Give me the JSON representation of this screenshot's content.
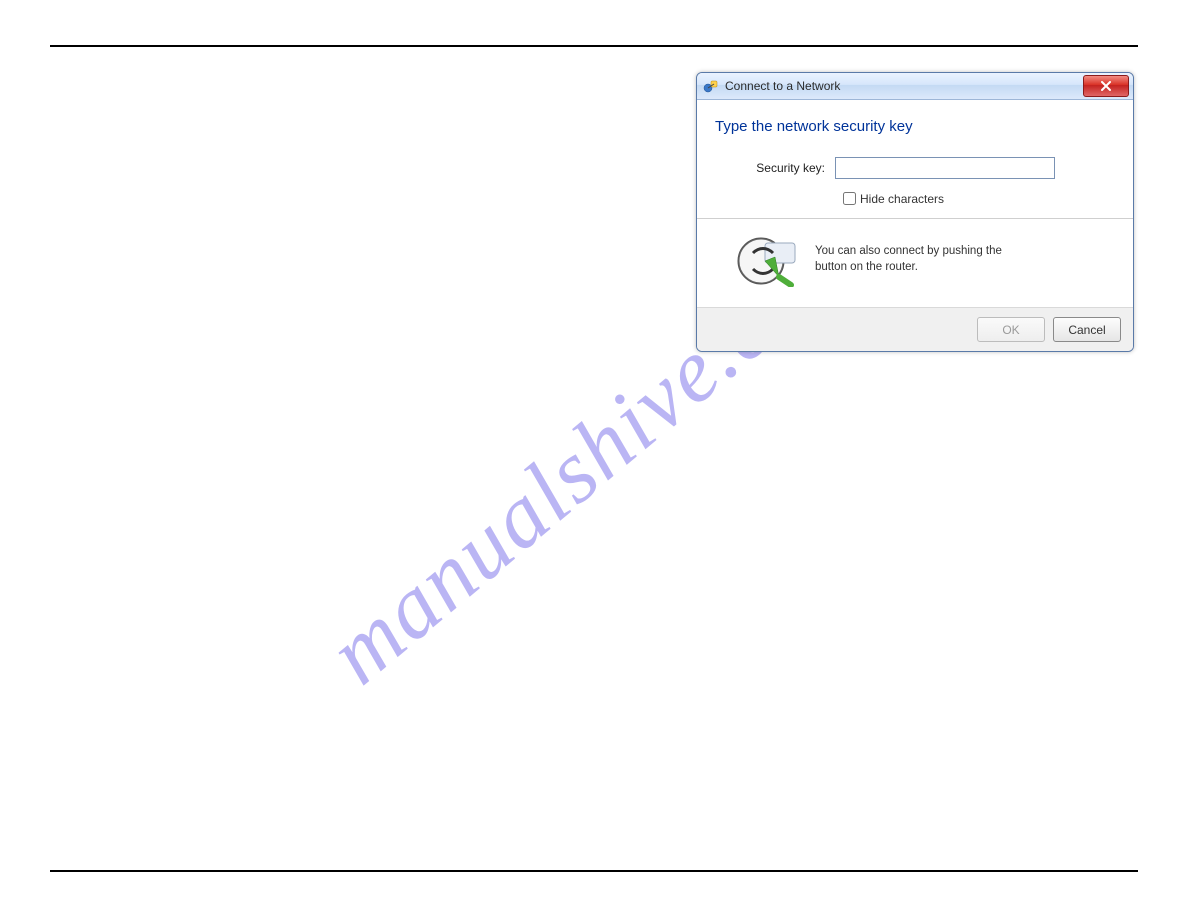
{
  "watermark": "manualshive.com",
  "dialog": {
    "title": "Connect to a Network",
    "heading": "Type the network security key",
    "security_key_label": "Security key:",
    "security_key_value": "",
    "hide_chars_label": "Hide characters",
    "info_line1": "You can also connect by pushing the",
    "info_line2": "button on the router.",
    "ok_label": "OK",
    "cancel_label": "Cancel"
  }
}
